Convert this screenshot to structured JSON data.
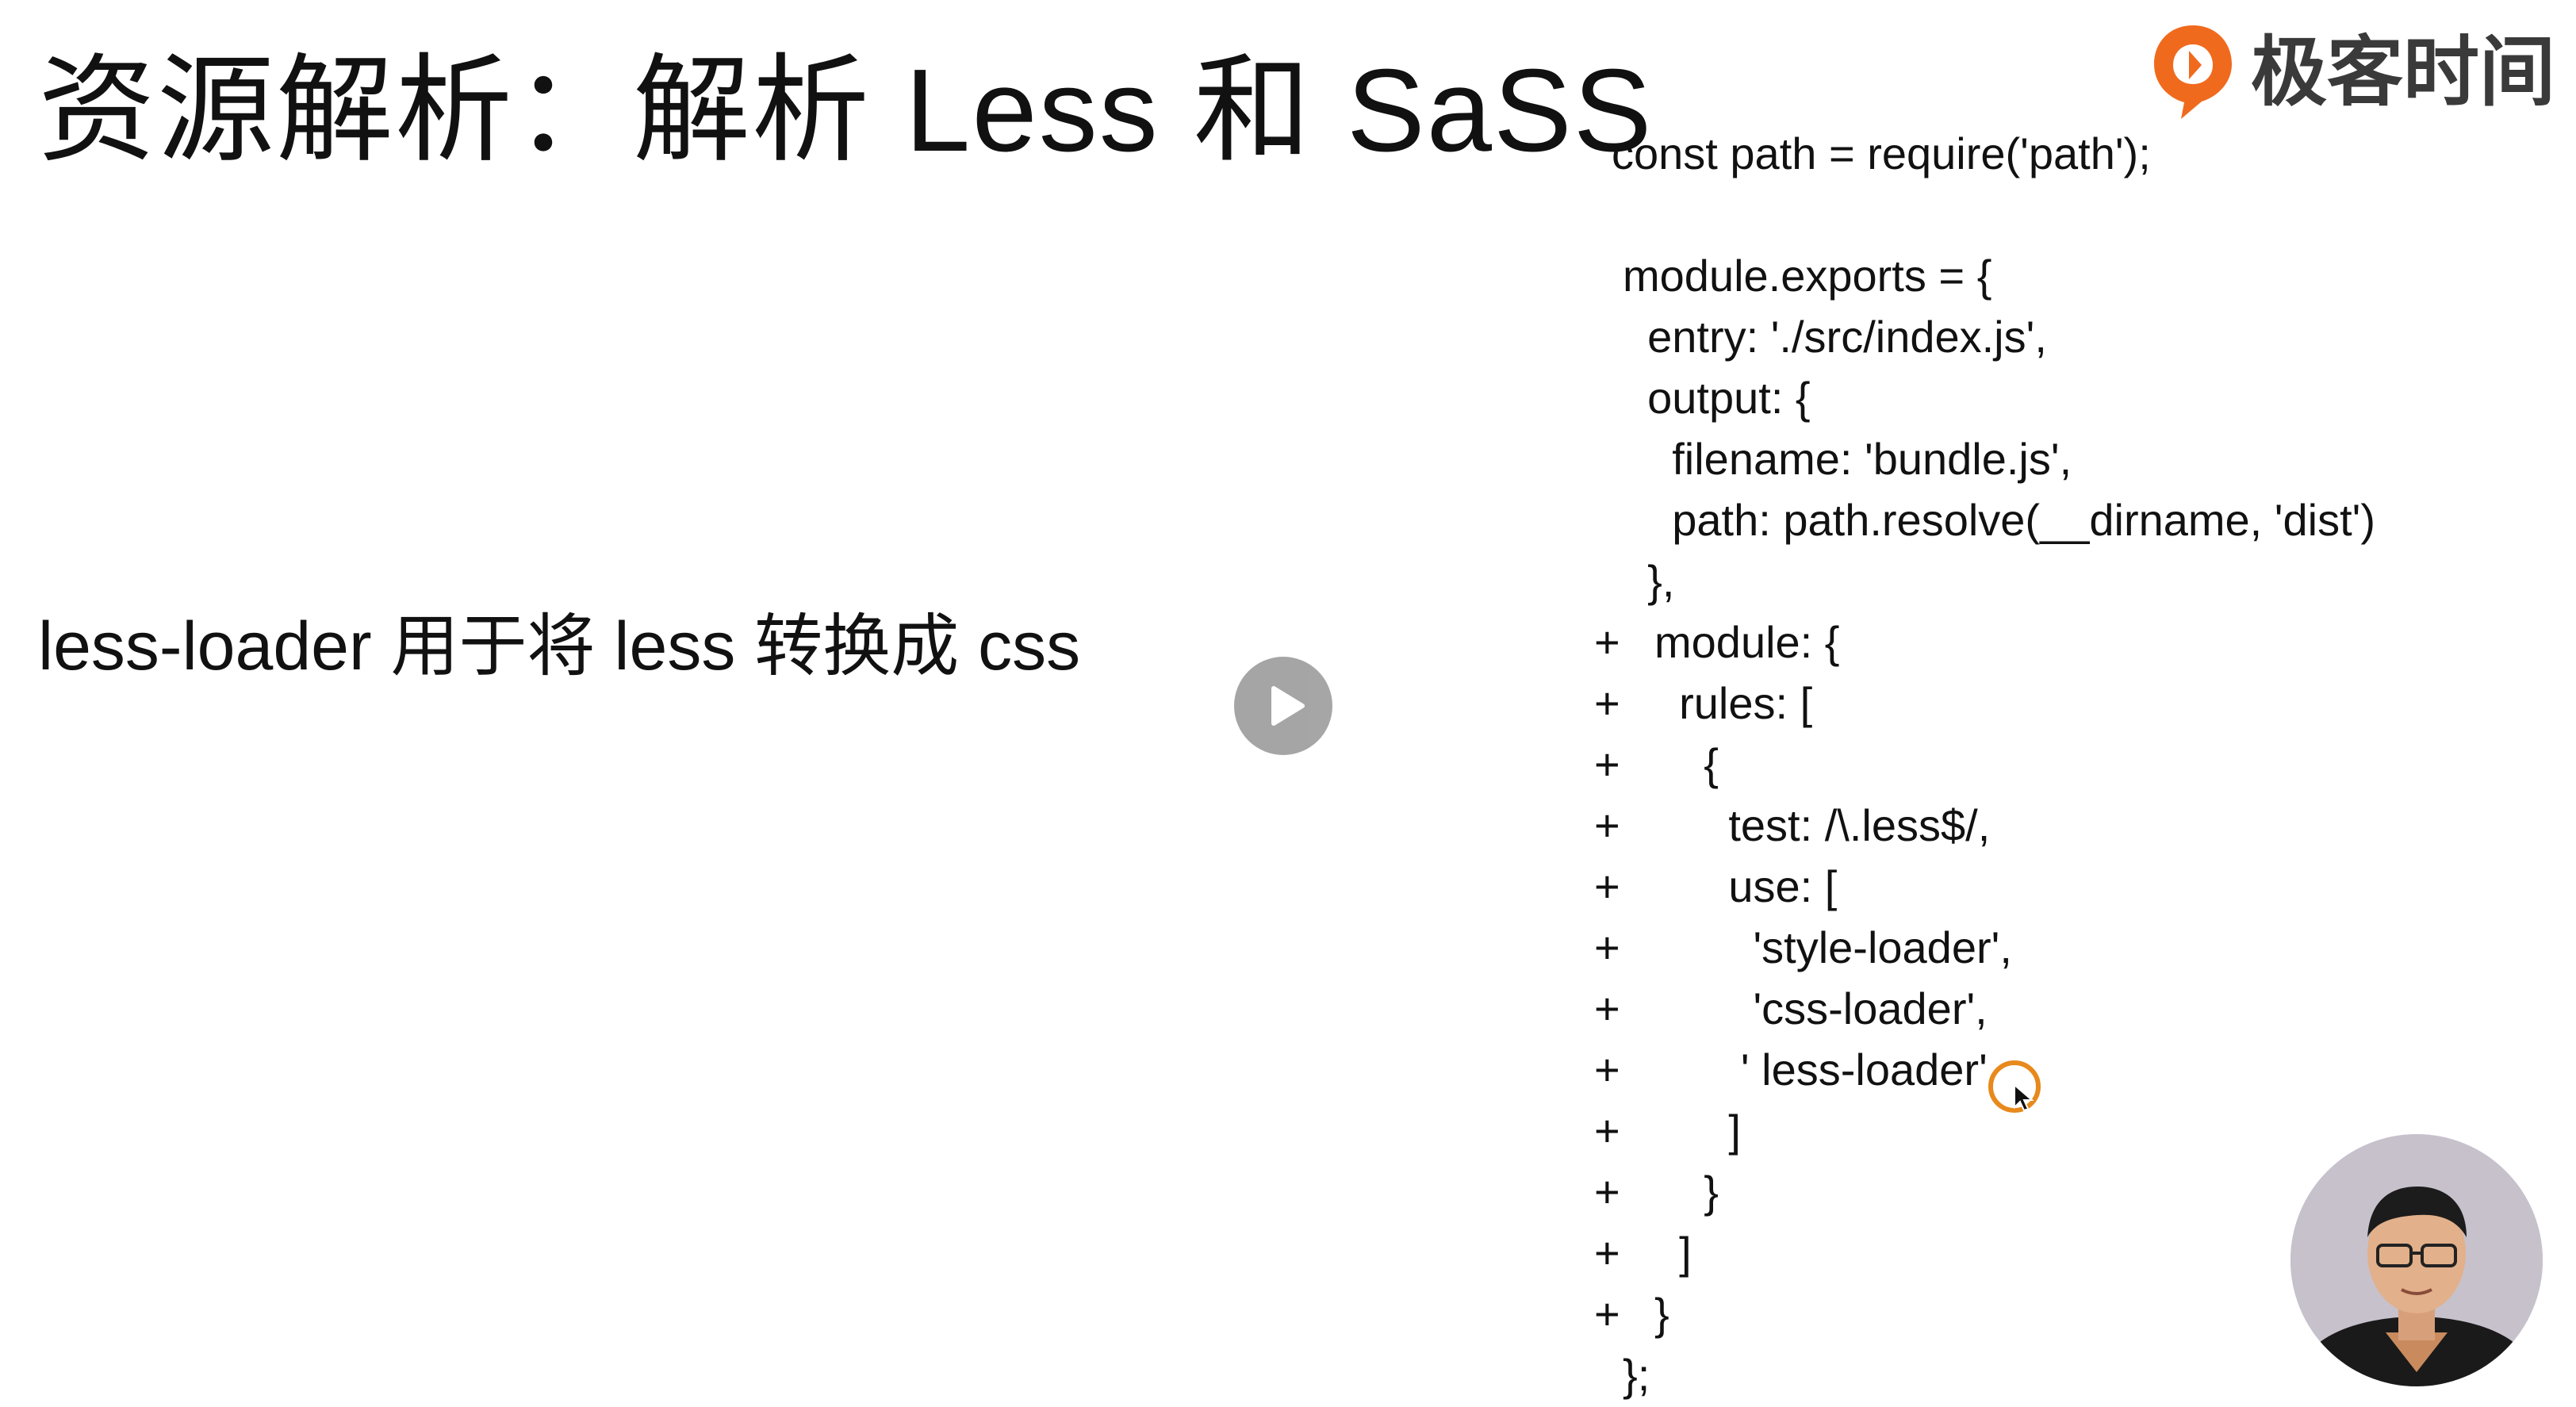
{
  "slide": {
    "title": "资源解析：解析 Less 和 SaSS",
    "subtitle": "less-loader 用于将 less 转换成 css"
  },
  "brand": {
    "name": "极客时间",
    "accent_color": "#F06A1E",
    "icon": "geektime-logo-icon"
  },
  "player": {
    "play_icon": "play-icon"
  },
  "code": {
    "lines": [
      {
        "marker": "",
        "text": "const path = require('path');"
      },
      {
        "marker": "",
        "text": ""
      },
      {
        "marker": "",
        "text": "module.exports = {"
      },
      {
        "marker": "",
        "text": "  entry: './src/index.js',"
      },
      {
        "marker": "",
        "text": "  output: {"
      },
      {
        "marker": "",
        "text": "    filename: 'bundle.js',"
      },
      {
        "marker": "",
        "text": "    path: path.resolve(__dirname, 'dist')"
      },
      {
        "marker": "",
        "text": "  },"
      },
      {
        "marker": "+",
        "text": "module: {"
      },
      {
        "marker": "+",
        "text": "  rules: ["
      },
      {
        "marker": "+",
        "text": "    {"
      },
      {
        "marker": "+",
        "text": "      test: /\\.less$/,"
      },
      {
        "marker": "+",
        "text": "      use: ["
      },
      {
        "marker": "+",
        "text": "        'style-loader',"
      },
      {
        "marker": "+",
        "text": "        'css-loader',"
      },
      {
        "marker": "+",
        "text": "       ' less-loader'"
      },
      {
        "marker": "+",
        "text": "      ]"
      },
      {
        "marker": "+",
        "text": "    }"
      },
      {
        "marker": "+",
        "text": "  ]"
      },
      {
        "marker": "+",
        "text": "}"
      },
      {
        "marker": "",
        "text": "};"
      }
    ]
  },
  "cursor": {
    "icon": "mouse-cursor-icon",
    "highlight_color": "#E8891C"
  },
  "presenter": {
    "icon": "presenter-avatar"
  }
}
